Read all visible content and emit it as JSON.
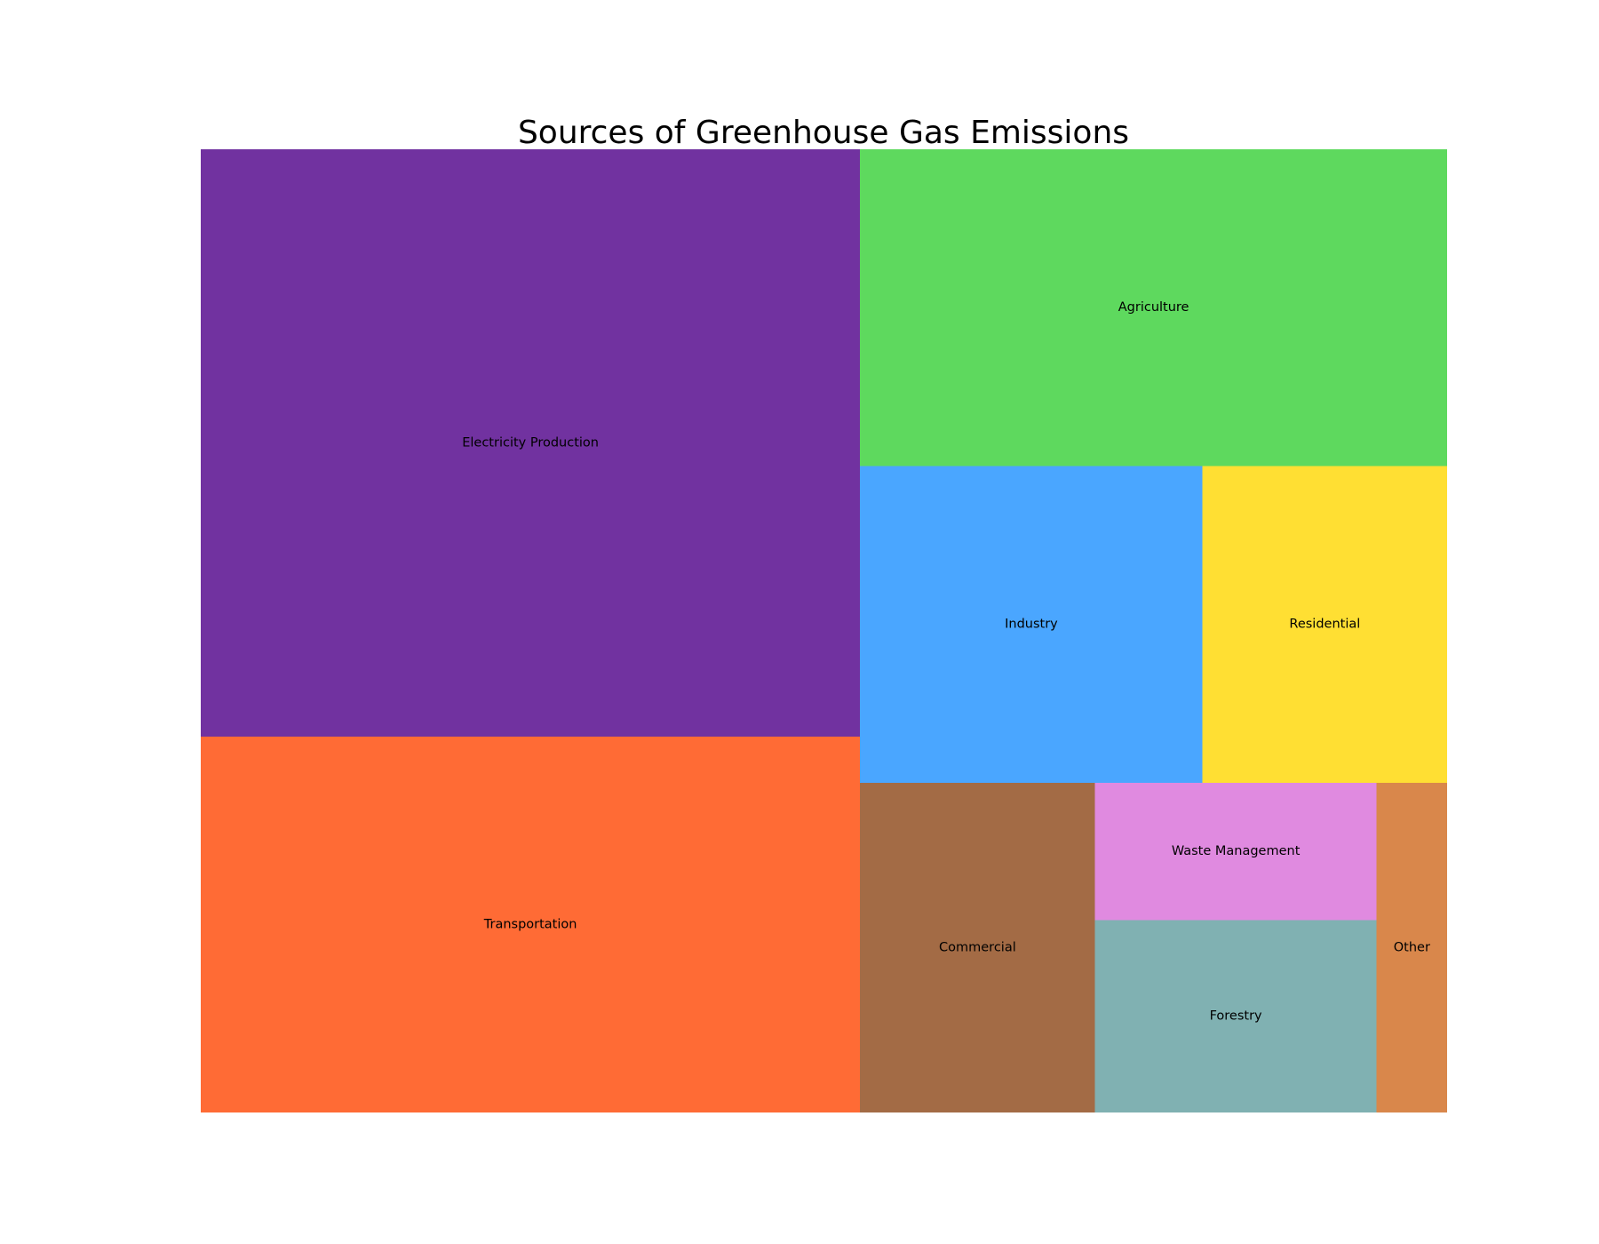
{
  "chart_data": {
    "type": "treemap",
    "title": "Sources of Greenhouse Gas Emissions",
    "items": [
      {
        "label": "Electricity Production",
        "value": 25,
        "color": "#7132a0"
      },
      {
        "label": "Transportation",
        "value": 16,
        "color": "#ff6b35"
      },
      {
        "label": "Agriculture",
        "value": 12,
        "color": "#5ed95e"
      },
      {
        "label": "Industry",
        "value": 7,
        "color": "#4aa6ff"
      },
      {
        "label": "Residential",
        "value": 5,
        "color": "#ffdf33"
      },
      {
        "label": "Commercial",
        "value": 5,
        "color": "#a36b45"
      },
      {
        "label": "Waste Management",
        "value": 2.5,
        "color": "#e08ae0"
      },
      {
        "label": "Forestry",
        "value": 3.5,
        "color": "#80b1b2"
      },
      {
        "label": "Other",
        "value": 1.5,
        "color": "#d9874b"
      }
    ]
  }
}
